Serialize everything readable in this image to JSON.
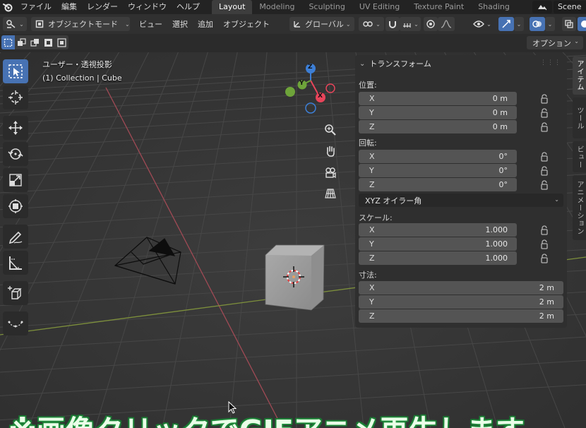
{
  "topbar": {
    "menus": [
      "ファイル",
      "編集",
      "レンダー",
      "ウィンドウ",
      "ヘルプ"
    ],
    "workspaces": [
      {
        "label": "Layout",
        "active": true
      },
      {
        "label": "Modeling",
        "active": false
      },
      {
        "label": "Sculpting",
        "active": false
      },
      {
        "label": "UV Editing",
        "active": false
      },
      {
        "label": "Texture Paint",
        "active": false
      },
      {
        "label": "Shading",
        "active": false
      }
    ],
    "scene_label": "Scene"
  },
  "header": {
    "mode_label": "オブジェクトモード",
    "menus": [
      "ビュー",
      "選択",
      "追加",
      "オブジェクト"
    ],
    "orientation_label": "グローバル"
  },
  "options_label": "オプション",
  "viewport": {
    "view_name": "ユーザー・透視投影",
    "collection_info": "(1) Collection | Cube"
  },
  "gizmo": {
    "x": "X",
    "y": "Y",
    "z": "Z"
  },
  "transform": {
    "title": "トランスフォーム",
    "location": {
      "label": "位置:",
      "x": "0 m",
      "y": "0 m",
      "z": "0 m"
    },
    "rotation": {
      "label": "回転:",
      "x": "0°",
      "y": "0°",
      "z": "0°"
    },
    "rotation_mode": "XYZ オイラー角",
    "scale": {
      "label": "スケール:",
      "x": "1.000",
      "y": "1.000",
      "z": "1.000"
    },
    "dimensions": {
      "label": "寸法:",
      "x": "2 m",
      "y": "2 m",
      "z": "2 m"
    },
    "axis_x": "X",
    "axis_y": "Y",
    "axis_z": "Z"
  },
  "sidetabs": [
    "アイテム",
    "ツール",
    "ビュー",
    "アニメーション"
  ],
  "caption": "※画像クリックでGIFアニメ再生します",
  "colors": {
    "accent": "#4772b3",
    "axis_x": "#e8445a",
    "axis_y": "#6ea43a",
    "axis_z": "#3d7fd6",
    "caption_glow": "#2aa54a"
  }
}
